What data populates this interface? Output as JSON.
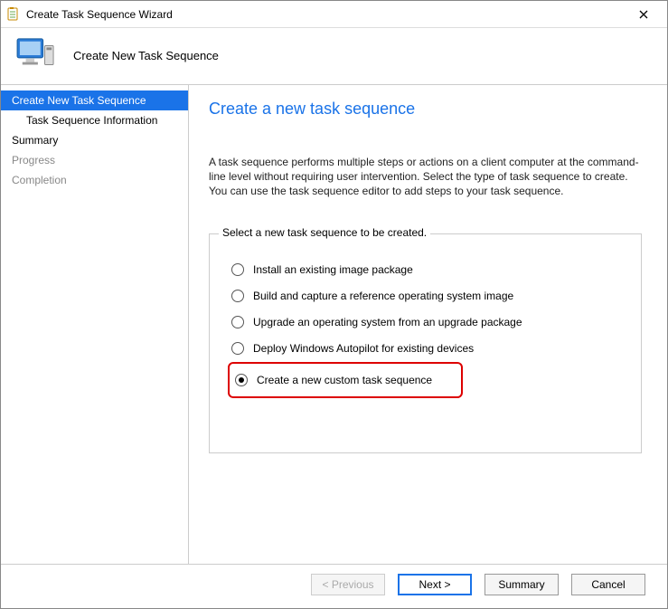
{
  "window": {
    "title": "Create Task Sequence Wizard"
  },
  "header": {
    "subtitle": "Create New Task Sequence"
  },
  "sidebar": {
    "steps": [
      {
        "label": "Create New Task Sequence",
        "active": true,
        "indent": false
      },
      {
        "label": "Task Sequence Information",
        "active": false,
        "indent": true
      },
      {
        "label": "Summary",
        "active": false,
        "indent": false
      },
      {
        "label": "Progress",
        "active": false,
        "indent": false,
        "disabled": true
      },
      {
        "label": "Completion",
        "active": false,
        "indent": false,
        "disabled": true
      }
    ]
  },
  "content": {
    "page_title": "Create a new task sequence",
    "description": "A task sequence performs multiple steps or actions on a client computer at the command-line level without requiring user intervention. Select the type of task sequence to create. You can use the task sequence editor to add steps to your task sequence.",
    "group_label": "Select a new task sequence to be created.",
    "options": [
      {
        "label": "Install an existing image package",
        "selected": false
      },
      {
        "label": "Build and capture a reference operating system image",
        "selected": false
      },
      {
        "label": "Upgrade an operating system from an upgrade package",
        "selected": false
      },
      {
        "label": "Deploy Windows Autopilot for existing devices",
        "selected": false
      },
      {
        "label": "Create a new custom task sequence",
        "selected": true,
        "highlight": true
      }
    ]
  },
  "footer": {
    "previous": "< Previous",
    "next": "Next >",
    "summary": "Summary",
    "cancel": "Cancel"
  }
}
